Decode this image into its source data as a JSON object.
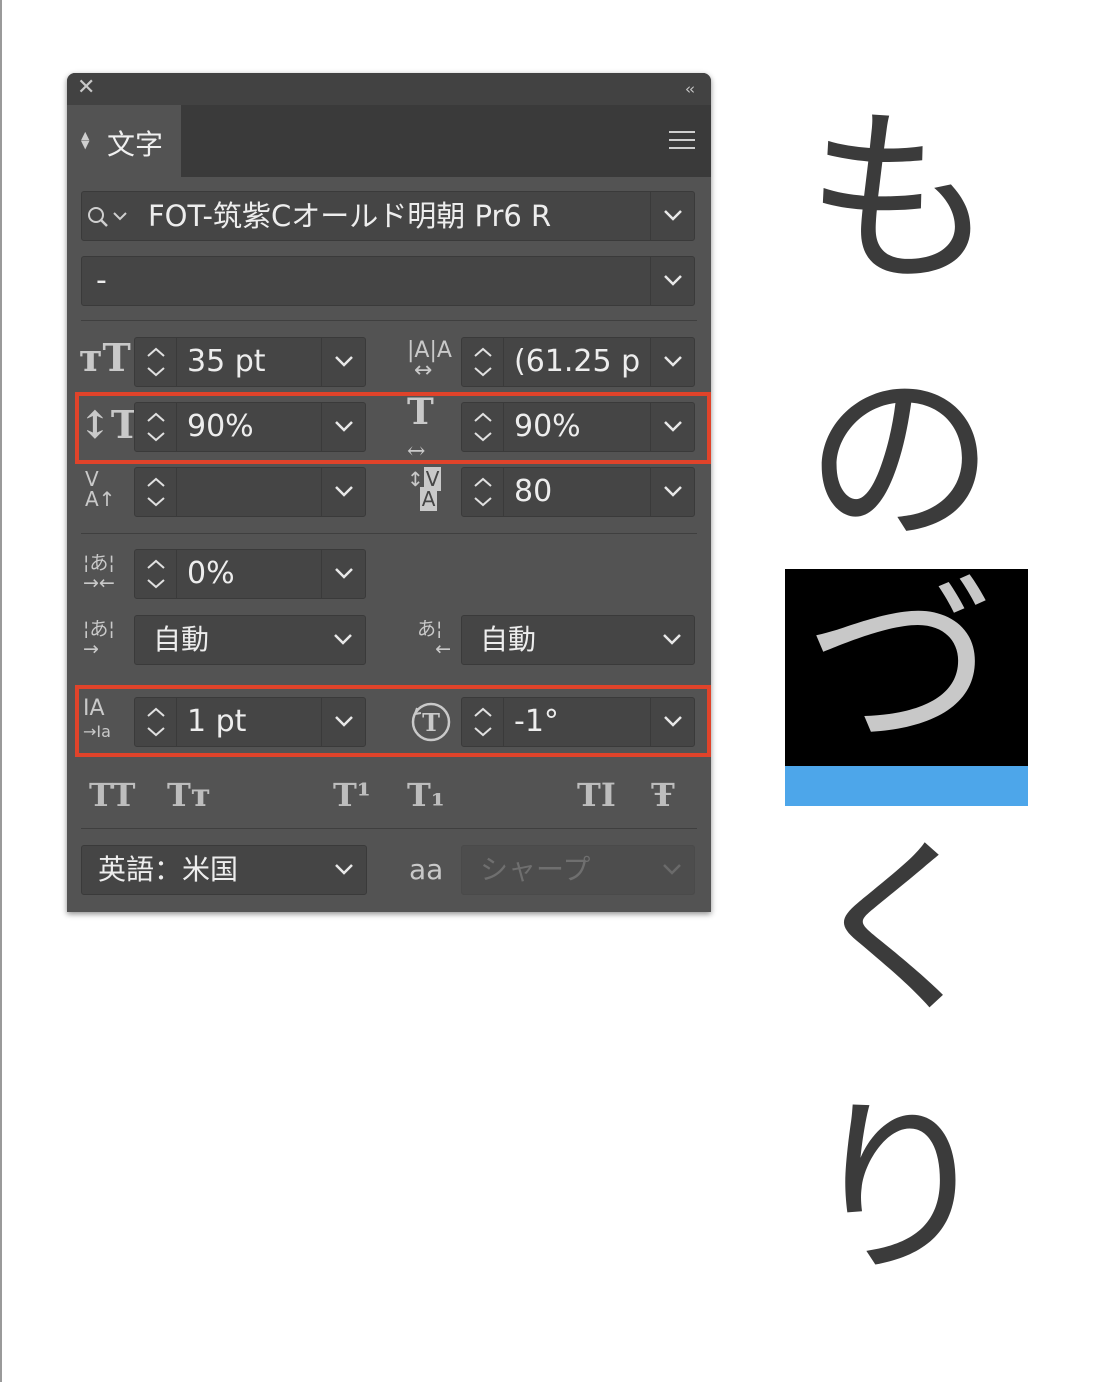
{
  "panel": {
    "tab_label": "文字",
    "font_family": "FOT-筑紫Cオールド明朝 Pr6 R",
    "font_style": "-",
    "font_size": "35 pt",
    "leading": "(61.25 p",
    "vertical_scale": "90%",
    "horizontal_scale": "90%",
    "kerning": "",
    "tracking": "80",
    "tsume": "0%",
    "aki_left": "自動",
    "aki_right": "自動",
    "baseline_shift": "1 pt",
    "rotation": "-1°",
    "language": "英語：米国",
    "antialias": "シャープ",
    "antialias_icon": "aa"
  },
  "text_buttons": [
    "TT",
    "Tт",
    "T¹",
    "T₁",
    "TI",
    "Ŧ"
  ],
  "canvas": {
    "chars": [
      "も",
      "の",
      "づ",
      "く",
      "り"
    ]
  },
  "colors": {
    "panel_bg": "#535353",
    "highlight": "#e0432a",
    "selection_bar": "#4da6ea"
  }
}
